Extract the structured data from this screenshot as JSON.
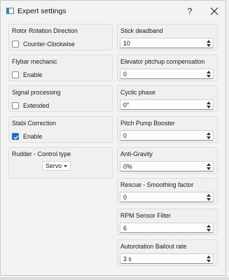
{
  "window": {
    "title": "Expert settings",
    "help_label": "?",
    "close_icon": "close-icon",
    "app_icon": "window-app-icon"
  },
  "left_groups": {
    "rotor_direction": {
      "title": "Rotor Rotation Direction",
      "label": "Counter-Clockwise",
      "checked": false
    },
    "flybar": {
      "title": "Flybar mechanic",
      "label": "Enable",
      "checked": false
    },
    "signal": {
      "title": "Signal processing",
      "label": "Extended",
      "checked": false
    },
    "stabi": {
      "title": "Stabi Correction",
      "label": "Enable",
      "checked": true
    },
    "rudder": {
      "title": "Rudder - Control type",
      "value": "Servo"
    }
  },
  "right_groups": {
    "stick_deadband": {
      "title": "Stick deadband",
      "value": "10"
    },
    "elevator_pitchup": {
      "title": "Elevator pitchup compensation",
      "value": "0"
    },
    "cyclic_phase": {
      "title": "Cyclic phase",
      "value": "0°"
    },
    "pitch_pump": {
      "title": "Pitch Pump Booster",
      "value": "0"
    },
    "anti_gravity": {
      "title": "Anti-Gravity",
      "value": "0%"
    },
    "rescue_smoothing": {
      "title": "Rescue - Smoothing factor",
      "value": "0"
    },
    "rpm_filter": {
      "title": "RPM Sensor Filter",
      "value": "6"
    },
    "autorotation": {
      "title": "Autorotation Bailout rate",
      "value": "3 s"
    }
  },
  "colors": {
    "accent": "#1f6fcf",
    "background": "#f0f0f0",
    "border": "#dcdcdc"
  }
}
